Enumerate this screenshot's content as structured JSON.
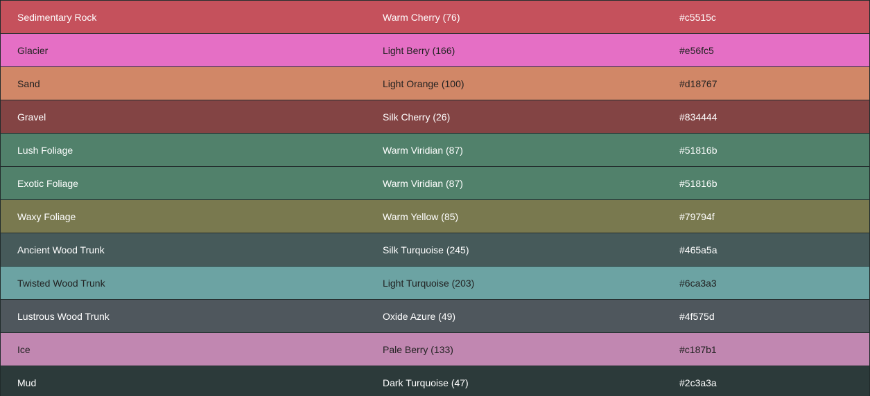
{
  "rows": [
    {
      "name": "Sedimentary Rock",
      "label": "Warm Cherry (76)",
      "hex": "#c5515c",
      "text": "light"
    },
    {
      "name": "Glacier",
      "label": "Light Berry (166)",
      "hex": "#e56fc5",
      "text": "dark"
    },
    {
      "name": "Sand",
      "label": "Light Orange (100)",
      "hex": "#d18767",
      "text": "dark"
    },
    {
      "name": "Gravel",
      "label": "Silk Cherry (26)",
      "hex": "#834444",
      "text": "light"
    },
    {
      "name": "Lush Foliage",
      "label": "Warm Viridian (87)",
      "hex": "#51816b",
      "text": "light"
    },
    {
      "name": "Exotic Foliage",
      "label": "Warm Viridian (87)",
      "hex": "#51816b",
      "text": "light"
    },
    {
      "name": "Waxy Foliage",
      "label": "Warm Yellow (85)",
      "hex": "#79794f",
      "text": "light"
    },
    {
      "name": "Ancient Wood Trunk",
      "label": "Silk Turquoise (245)",
      "hex": "#465a5a",
      "text": "light"
    },
    {
      "name": "Twisted Wood Trunk",
      "label": "Light Turquoise (203)",
      "hex": "#6ca3a3",
      "text": "dark"
    },
    {
      "name": "Lustrous Wood Trunk",
      "label": "Oxide Azure (49)",
      "hex": "#4f575d",
      "text": "light"
    },
    {
      "name": "Ice",
      "label": "Pale Berry (133)",
      "hex": "#c187b1",
      "text": "dark"
    },
    {
      "name": "Mud",
      "label": "Dark Turquoise (47)",
      "hex": "#2c3a3a",
      "text": "light"
    }
  ]
}
